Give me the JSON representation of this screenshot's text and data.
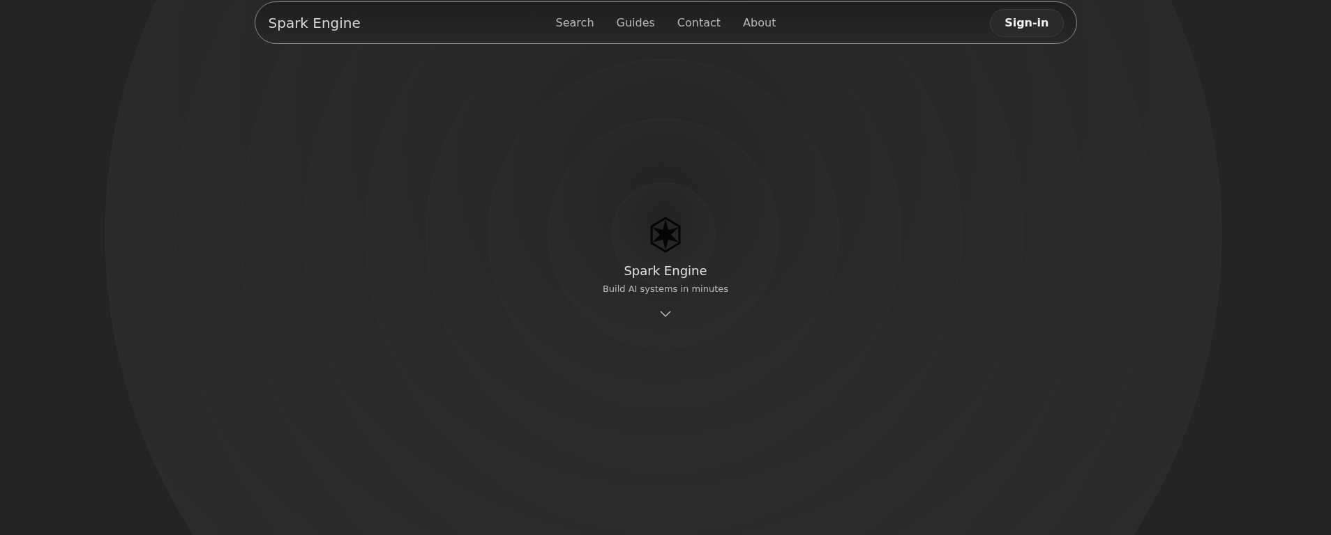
{
  "navbar": {
    "brand": "Spark Engine",
    "links": [
      {
        "label": "Search"
      },
      {
        "label": "Guides"
      },
      {
        "label": "Contact"
      },
      {
        "label": "About"
      }
    ],
    "sign_in": "Sign-in"
  },
  "hero": {
    "title": "Spark Engine",
    "subtitle": "Build AI systems in minutes"
  }
}
